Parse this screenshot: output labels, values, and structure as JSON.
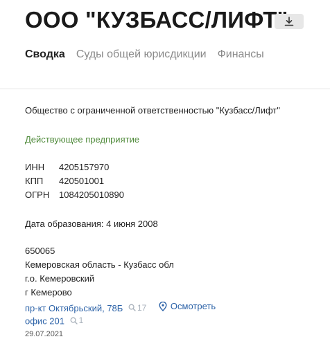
{
  "header": {
    "title": "ООО \"КУЗБАСС/ЛИФТ\"",
    "download_icon": "download-icon"
  },
  "tabs": [
    {
      "label": "Сводка",
      "active": true
    },
    {
      "label": "Суды общей юрисдикции",
      "active": false
    },
    {
      "label": "Финансы",
      "active": false
    }
  ],
  "company": {
    "full_name": "Общество с ограниченной ответственностью \"Кузбасс/Лифт\"",
    "status": "Действующее предприятие",
    "ids": [
      {
        "key": "ИНН",
        "value": "4205157970"
      },
      {
        "key": "КПП",
        "value": "420501001"
      },
      {
        "key": "ОГРН",
        "value": "1084205010890"
      }
    ],
    "founded": "Дата образования: 4 июня 2008"
  },
  "address": {
    "postcode": "650065",
    "region": "Кемеровская область - Кузбасс обл",
    "district": "г.о. Кемеровский",
    "city": "г Кемерово",
    "street": "пр-кт Октябрьский, 78Б",
    "street_count": "17",
    "view_label": "Осмотреть",
    "office": "офис 201",
    "office_count": "1",
    "date": "29.07.2021"
  },
  "colors": {
    "status_green": "#4f8a3a",
    "link_blue": "#2d63a8",
    "muted_gray": "#a8b1bb"
  }
}
